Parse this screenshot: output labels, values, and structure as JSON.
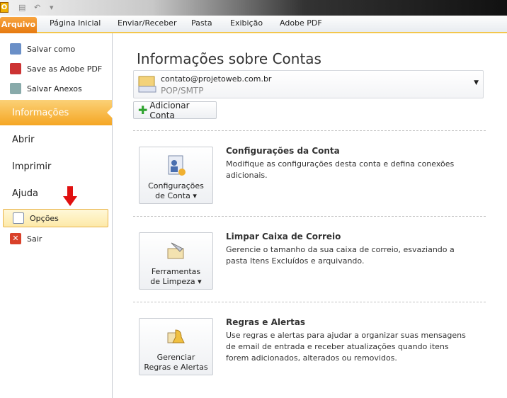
{
  "app": {
    "icon_letter": "O"
  },
  "ribbon": {
    "tabs": [
      "Arquivo",
      "Página Inicial",
      "Enviar/Receber",
      "Pasta",
      "Exibição",
      "Adobe PDF"
    ]
  },
  "sidebar": {
    "items": [
      {
        "label": "Salvar como"
      },
      {
        "label": "Save as Adobe PDF"
      },
      {
        "label": "Salvar Anexos"
      }
    ],
    "sections": [
      "Informações",
      "Abrir",
      "Imprimir",
      "Ajuda"
    ],
    "options": "Opções",
    "exit": "Sair"
  },
  "main": {
    "title": "Informações sobre Contas",
    "account": {
      "email": "contato@projetoweb.com.br",
      "type": "POP/SMTP"
    },
    "add_account": "Adicionar Conta",
    "sections": [
      {
        "button": [
          "Configurações",
          "de Conta"
        ],
        "title": "Configurações da Conta",
        "desc": "Modifique as configurações desta conta e defina conexões adicionais."
      },
      {
        "button": [
          "Ferramentas",
          "de Limpeza"
        ],
        "title": "Limpar Caixa de Correio",
        "desc": "Gerencie o tamanho da sua caixa de correio, esvaziando a pasta Itens Excluídos e arquivando."
      },
      {
        "button": [
          "Gerenciar",
          "Regras e Alertas"
        ],
        "title": "Regras e Alertas",
        "desc": "Use regras e alertas para ajudar a organizar suas mensagens de email de entrada e receber atualizações quando itens forem adicionados, alterados ou removidos."
      }
    ]
  }
}
